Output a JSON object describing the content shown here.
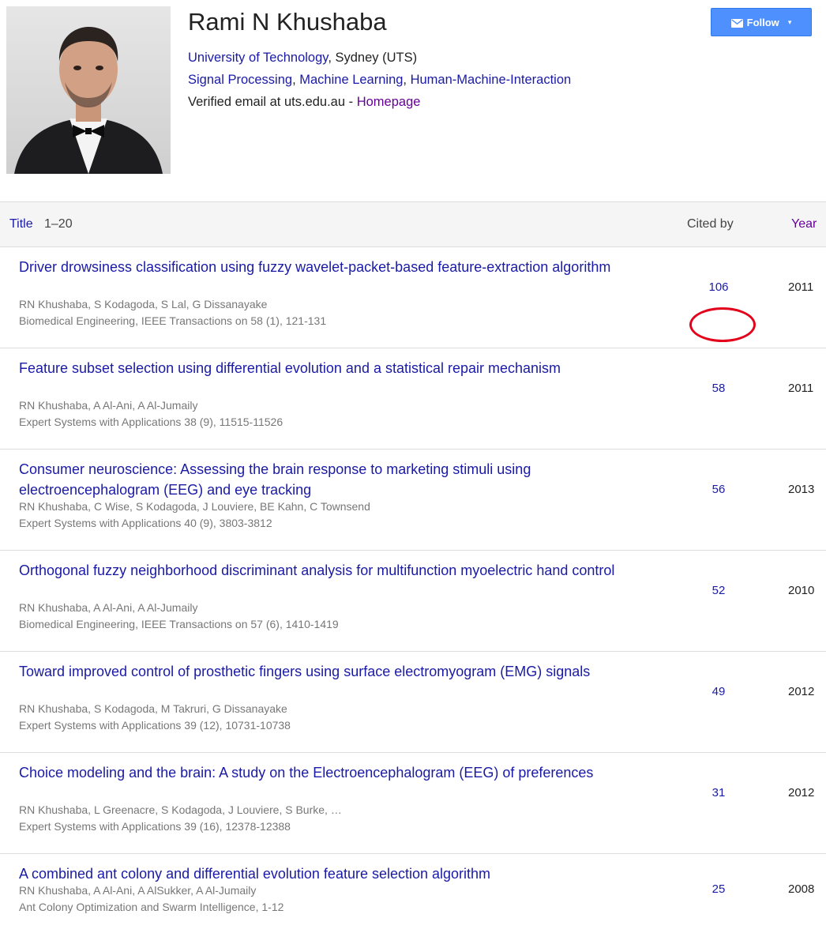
{
  "profile": {
    "name": "Rami N Khushaba",
    "affiliation_link": "University of Technology",
    "affiliation_rest": ", Sydney (UTS)",
    "interests": [
      "Signal Processing",
      "Machine Learning",
      "Human-Machine-Interaction"
    ],
    "interest_separator": ", ",
    "email_text": "Verified email at uts.edu.au - ",
    "homepage_label": "Homepage",
    "avatar_icon": "person-photo-icon"
  },
  "follow": {
    "label": "Follow",
    "icon": "mail-icon",
    "caret": "▾",
    "color": "#4d90fe"
  },
  "table": {
    "header": {
      "title": "Title",
      "range": "1–20",
      "cited_by": "Cited by",
      "year": "Year"
    },
    "rows": [
      {
        "title": "Driver drowsiness classification using fuzzy wavelet-packet-based feature-extraction algorithm",
        "authors": "RN Khushaba, S Kodagoda, S Lal, G Dissanayake",
        "venue": "Biomedical Engineering, IEEE Transactions on 58 (1), 121-131",
        "cited_by": "106",
        "year": "2011"
      },
      {
        "title": "Feature subset selection using differential evolution and a statistical repair mechanism",
        "authors": "RN Khushaba, A Al-Ani, A Al-Jumaily",
        "venue": "Expert Systems with Applications 38 (9), 11515-11526",
        "cited_by": "58",
        "year": "2011"
      },
      {
        "title": "Consumer neuroscience: Assessing the brain response to marketing stimuli using electroencephalogram (EEG) and eye tracking",
        "authors": "RN Khushaba, C Wise, S Kodagoda, J Louviere, BE Kahn, C Townsend",
        "venue": "Expert Systems with Applications 40 (9), 3803-3812",
        "cited_by": "56",
        "year": "2013"
      },
      {
        "title": "Orthogonal fuzzy neighborhood discriminant analysis for multifunction myoelectric hand control",
        "authors": "RN Khushaba, A Al-Ani, A Al-Jumaily",
        "venue": "Biomedical Engineering, IEEE Transactions on 57 (6), 1410-1419",
        "cited_by": "52",
        "year": "2010"
      },
      {
        "title": "Toward improved control of prosthetic fingers using surface electromyogram (EMG) signals",
        "authors": "RN Khushaba, S Kodagoda, M Takruri, G Dissanayake",
        "venue": "Expert Systems with Applications 39 (12), 10731-10738",
        "cited_by": "49",
        "year": "2012"
      },
      {
        "title": "Choice modeling and the brain: A study on the Electroencephalogram (EEG) of preferences",
        "authors": "RN Khushaba, L Greenacre, S Kodagoda, J Louviere, S Burke, …",
        "venue": "Expert Systems with Applications 39 (16), 12378-12388",
        "cited_by": "31",
        "year": "2012"
      },
      {
        "title": "A combined ant colony and differential evolution feature selection algorithm",
        "authors": "RN Khushaba, A Al-Ani, A AlSukker, A Al-Jumaily",
        "venue": "Ant Colony Optimization and Swarm Intelligence, 1-12",
        "cited_by": "25",
        "year": "2008"
      }
    ]
  },
  "annotation": {
    "type": "red-circle",
    "target": "cited_by of first row",
    "color": "#e3001b"
  }
}
